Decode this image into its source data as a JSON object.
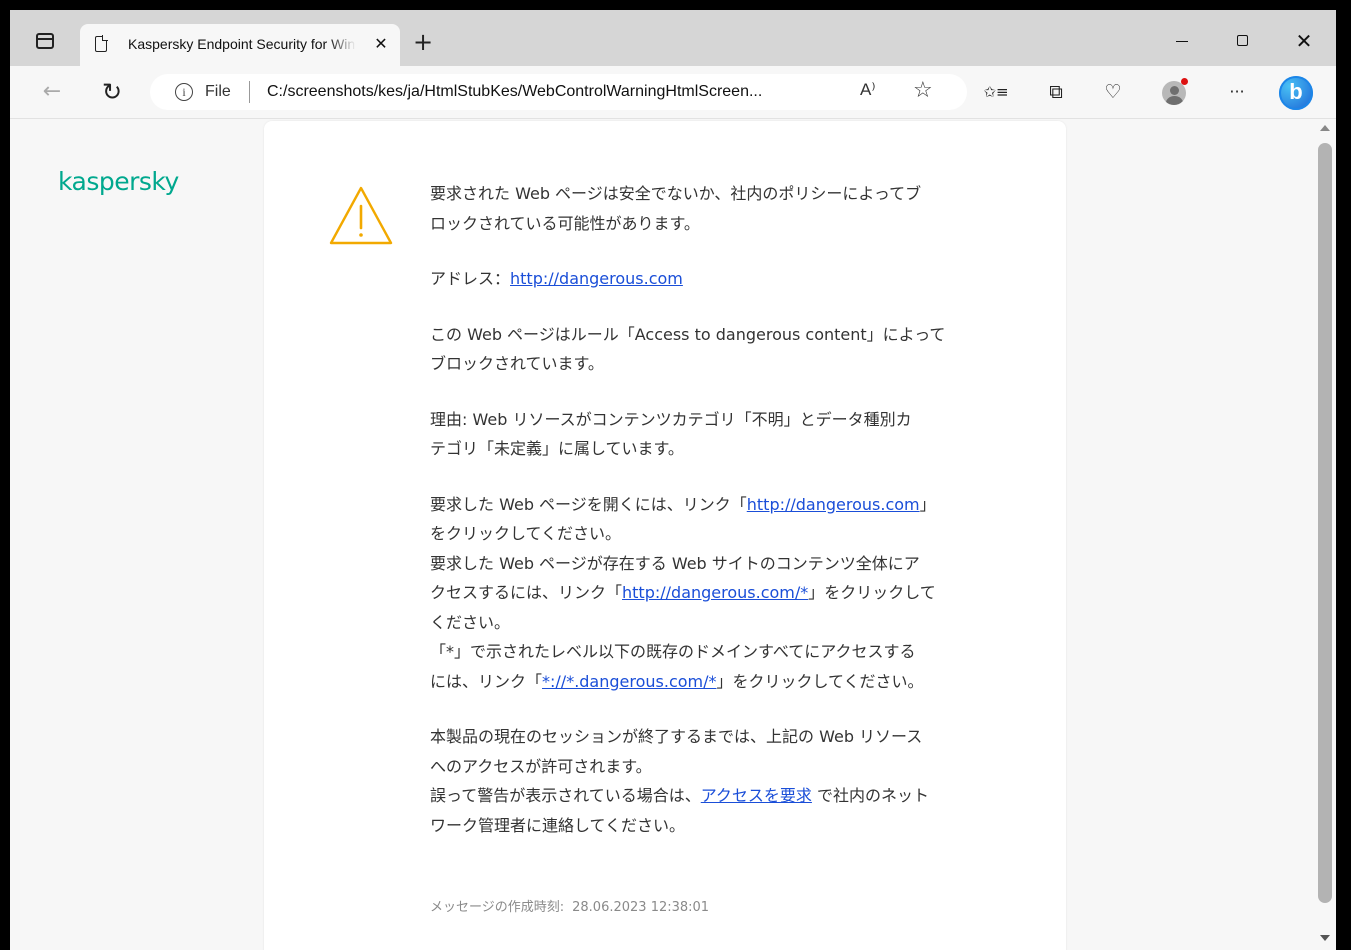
{
  "browser": {
    "tab_title": "Kaspersky Endpoint Security for Windows",
    "tab_close": "✕",
    "new_tab": "+",
    "address_scheme": "File",
    "address_url": "C:/screenshots/kes/ja/HtmlStubKes/WebControlWarningHtmlScreen...",
    "read_aloud": "A⁾",
    "favorite_star": "☆",
    "window_close": "✕",
    "icons": {
      "back": "←",
      "refresh": "↻",
      "favorites": "✩≡",
      "collections": "⧉",
      "health": "♡",
      "more": "···",
      "bing": "b"
    }
  },
  "page": {
    "logo": "kaspersky",
    "warning_line1": "要求された Web ページは安全でないか、社内のポリシーによってブ",
    "warning_line2": "ロックされている可能性があります。",
    "address_label": "アドレス：",
    "address_link": "http://dangerous.com",
    "rule_line1": "この Web ページはルール「Access to dangerous content」によって",
    "rule_line2": "ブロックされています。",
    "reason_line1": "理由: Web リソースがコンテンツカテゴリ「不明」とデータ種別カ",
    "reason_line2": "テゴリ「未定義」に属しています。",
    "open_line1_prefix": "要求した Web ページを開くには、リンク「",
    "open_link": "http://dangerous.com",
    "open_line1_suffix": "」",
    "open_line2": "をクリックしてください。",
    "site_line1": "要求した Web ページが存在する Web サイトのコンテンツ全体にア",
    "site_line2_prefix": "クセスするには、リンク「",
    "site_link": "http://dangerous.com/*",
    "site_line2_suffix": "」をクリックして",
    "site_line3": "ください。",
    "domain_line1": "「*」で示されたレベル以下の既存のドメインすべてにアクセスする",
    "domain_line2_prefix": "には、リンク「",
    "domain_link": "*://*.dangerous.com/*",
    "domain_line2_suffix": "」をクリックしてください。",
    "session_line1": "本製品の現在のセッションが終了するまでは、上記の Web リソース",
    "session_line2": "へのアクセスが許可されます。",
    "error_line1_prefix": "誤って警告が表示されている場合は、",
    "request_link": "アクセスを要求",
    "error_line1_suffix": " で社内のネット",
    "error_line2": "ワーク管理者に連絡してください。",
    "timestamp_label": "メッセージの作成時刻:",
    "timestamp_value": "28.06.2023 12:38:01"
  },
  "colors": {
    "brand": "#00a88e",
    "warning_icon": "#f2a900",
    "link": "#1a4ed8"
  }
}
